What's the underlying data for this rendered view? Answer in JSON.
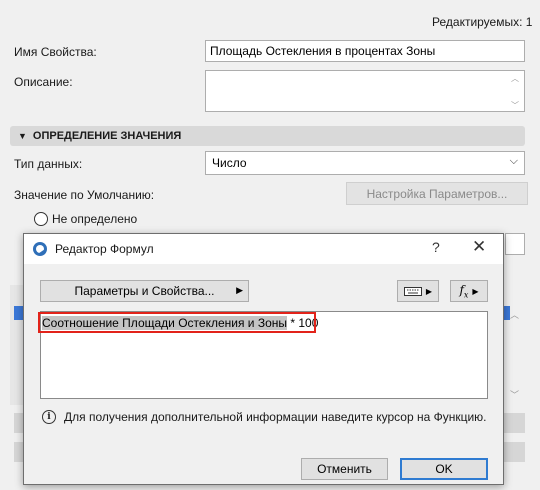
{
  "header": {
    "editable_count": "Редактируемых: 1"
  },
  "property": {
    "name_label": "Имя Свойства:",
    "name_value": "Площадь Остекления в процентах Зоны",
    "description_label": "Описание:",
    "description_value": ""
  },
  "section": {
    "title": "ОПРЕДЕЛЕНИЕ ЗНАЧЕНИЯ"
  },
  "data_type": {
    "label": "Тип данных:",
    "value": "Число"
  },
  "default_value": {
    "label": "Значение по Умолчанию:",
    "settings_button": "Настройка Параметров...",
    "radio_undefined": "Не определено"
  },
  "dialog": {
    "title": "Редактор Формул",
    "help": "?",
    "close": "✕",
    "params_button": "Параметры и Свойства...",
    "fx_label": "f",
    "fx_sub": "x",
    "formula_highlight": "Соотношение Площади Остекления и Зоны",
    "formula_rest": " * 100",
    "info_text": "Для получения дополнительной информации наведите курсор на Функцию.",
    "cancel_button": "Отменить",
    "ok_button": "OK"
  },
  "colors": {
    "highlight_border": "#e2231a",
    "ok_border": "#2f7bd1"
  },
  "icons": [
    "app-logo-icon",
    "help-icon",
    "close-icon",
    "keyboard-icon",
    "function-icon",
    "info-icon",
    "chevron-down-icon",
    "collapse-triangle-icon"
  ]
}
